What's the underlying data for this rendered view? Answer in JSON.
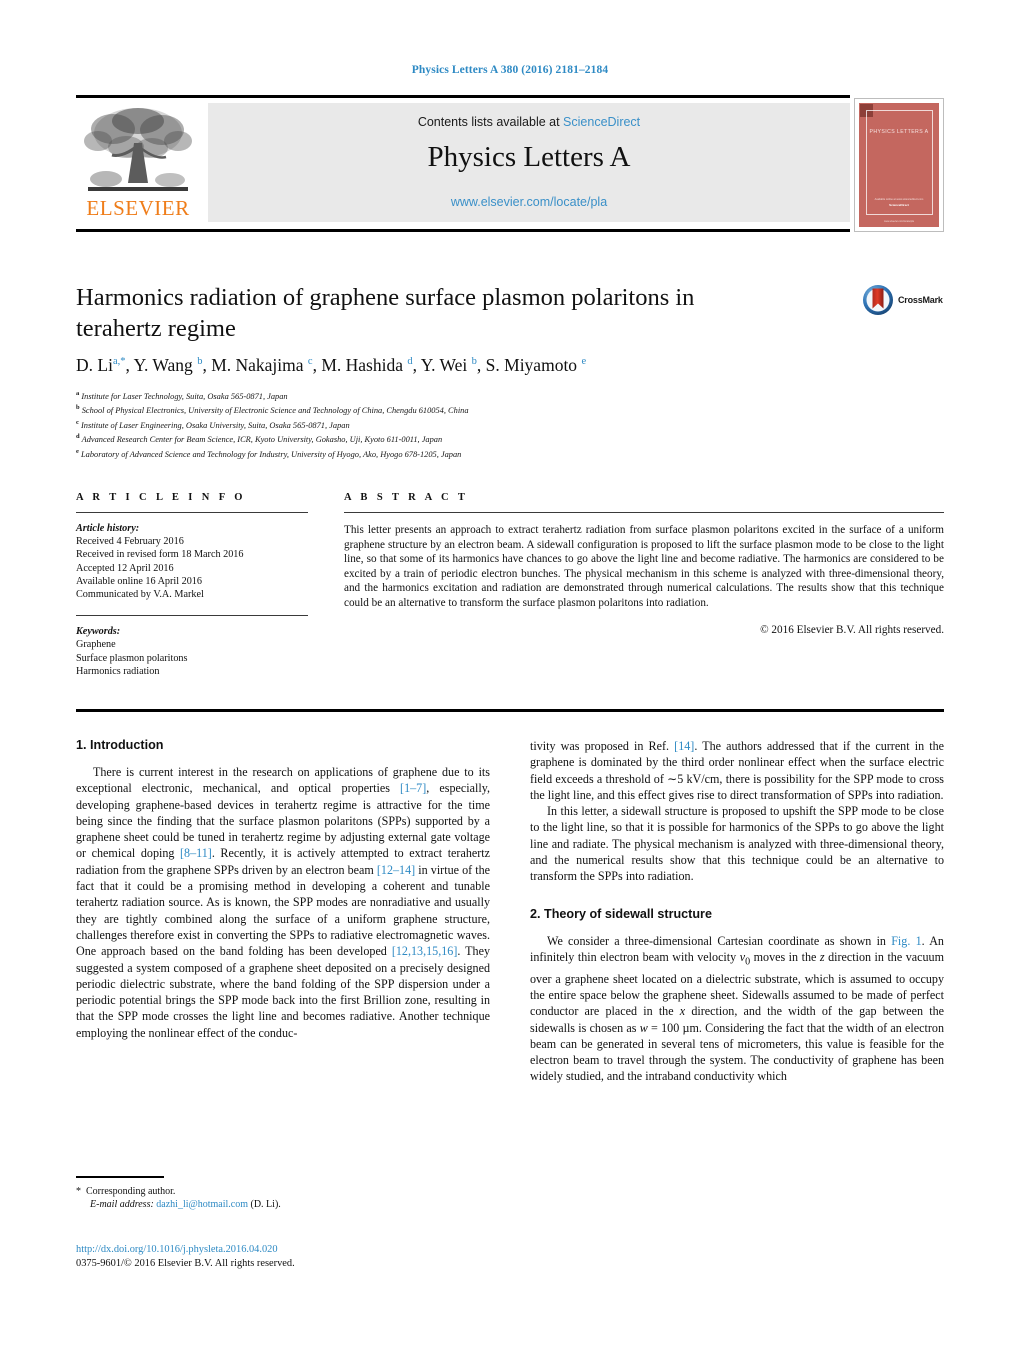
{
  "running_head": "Physics Letters A 380 (2016) 2181–2184",
  "masthead": {
    "contents_prefix": "Contents lists available at ",
    "contents_link": "ScienceDirect",
    "journal_title": "Physics Letters A",
    "journal_url": "www.elsevier.com/locate/pla",
    "publisher_logo_word": "ELSEVIER",
    "cover": {
      "name": "PHYSICS LETTERS A",
      "foot1": "Available online at www.sciencedirect.com",
      "foot2": "ScienceDirect",
      "foot3": "www.elsevier.com/locate/pla"
    }
  },
  "article": {
    "title": "Harmonics radiation of graphene surface plasmon polaritons in terahertz regime",
    "crossmark_label": "CrossMark",
    "authors_html": "D. Li<sup class=\"star\">a,*</sup>, Y. Wang <sup>b</sup>, M. Nakajima <sup>c</sup>, M. Hashida <sup>d</sup>, Y. Wei <sup>b</sup>, S. Miyamoto <sup>e</sup>",
    "affiliations": [
      {
        "marker": "a",
        "text": "Institute for Laser Technology, Suita, Osaka 565-0871, Japan"
      },
      {
        "marker": "b",
        "text": "School of Physical Electronics, University of Electronic Science and Technology of China, Chengdu 610054, China"
      },
      {
        "marker": "c",
        "text": "Institute of Laser Engineering, Osaka University, Suita, Osaka 565-0871, Japan"
      },
      {
        "marker": "d",
        "text": "Advanced Research Center for Beam Science, ICR, Kyoto University, Gokasho, Uji, Kyoto 611-0011, Japan"
      },
      {
        "marker": "e",
        "text": "Laboratory of Advanced Science and Technology for Industry, University of Hyogo, Ako, Hyogo 678-1205, Japan"
      }
    ]
  },
  "article_info": {
    "heading": "A R T I C L E   I N F O",
    "history_label": "Article history:",
    "history": [
      "Received 4 February 2016",
      "Received in revised form 18 March 2016",
      "Accepted 12 April 2016",
      "Available online 16 April 2016",
      "Communicated by V.A. Markel"
    ],
    "keywords_label": "Keywords:",
    "keywords": [
      "Graphene",
      "Surface plasmon polaritons",
      "Harmonics radiation"
    ]
  },
  "abstract": {
    "heading": "A B S T R A C T",
    "text": "This letter presents an approach to extract terahertz radiation from surface plasmon polaritons excited in the surface of a uniform graphene structure by an electron beam. A sidewall configuration is proposed to lift the surface plasmon mode to be close to the light line, so that some of its harmonics have chances to go above the light line and become radiative. The harmonics are considered to be excited by a train of periodic electron bunches. The physical mechanism in this scheme is analyzed with three-dimensional theory, and the harmonics excitation and radiation are demonstrated through numerical calculations. The results show that this technique could be an alternative to transform the surface plasmon polaritons into radiation.",
    "copyright": "© 2016 Elsevier B.V. All rights reserved."
  },
  "sections": {
    "intro_heading": "1. Introduction",
    "theory_heading": "2. Theory of sidewall structure",
    "intro_p1_html": "There is current interest in the research on applications of graphene due to its exceptional electronic, mechanical, and optical properties <a class=\"ref\" href=\"#\">[1–7]</a>, especially, developing graphene-based devices in terahertz regime is attractive for the time being since the finding that the surface plasmon polaritons (SPPs) supported by a graphene sheet could be tuned in terahertz regime by adjusting external gate voltage or chemical doping <a class=\"ref\" href=\"#\">[8–11]</a>. Recently, it is actively attempted to extract terahertz radiation from the graphene SPPs driven by an electron beam <a class=\"ref\" href=\"#\">[12–14]</a> in virtue of the fact that it could be a promising method in developing a coherent and tunable terahertz radiation source. As is known, the SPP modes are nonradiative and usually they are tightly combined along the surface of a uniform graphene structure, challenges therefore exist in converting the SPPs to radiative electromagnetic waves. One approach based on the band folding has been developed <a class=\"ref\" href=\"#\">[12,13,15,16]</a>. They suggested a system composed of a graphene sheet deposited on a precisely designed periodic dielectric substrate, where the band folding of the SPP dispersion under a periodic potential brings the SPP mode back into the first Brillion zone, resulting in that the SPP mode crosses the light line and becomes radiative. Another technique employing the nonlinear effect of the conduc-",
    "right_p1_html": "tivity was proposed in Ref. <a class=\"ref\" href=\"#\">[14]</a>. The authors addressed that if the current in the graphene is dominated by the third order nonlinear effect when the surface electric field exceeds a threshold of ∼5 kV/cm, there is possibility for the SPP mode to cross the light line, and this effect gives rise to direct transformation of SPPs into radiation.",
    "right_p2_html": "In this letter, a sidewall structure is proposed to upshift the SPP mode to be close to the light line, so that it is possible for harmonics of the SPPs to go above the light line and radiate. The physical mechanism is analyzed with three-dimensional theory, and the numerical results show that this technique could be an alternative to transform the SPPs into radiation.",
    "right_p3_html": "We consider a three-dimensional Cartesian coordinate as shown in <a class=\"ref\" href=\"#\">Fig. 1</a>. An infinitely thin electron beam with velocity <span class=\"em\">v</span><sub>0</sub> moves in the <span class=\"em\">z</span> direction in the vacuum over a graphene sheet located on a dielectric substrate, which is assumed to occupy the entire space below the graphene sheet. Sidewalls assumed to be made of perfect conductor are placed in the <span class=\"em\">x</span> direction, and the width of the gap between the sidewalls is chosen as <span class=\"em\">w</span> = 100 µm. Considering the fact that the width of an electron beam can be generated in several tens of micrometers, this value is feasible for the electron beam to travel through the system. The conductivity of graphene has been widely studied, and the intraband conductivity which"
  },
  "footnotes": {
    "corresponding_marker": "*",
    "corresponding_text": "Corresponding author.",
    "email_label": "E-mail address:",
    "email": "dazhi_li@hotmail.com",
    "email_owner": "(D. Li).",
    "doi_url": "http://dx.doi.org/10.1016/j.physleta.2016.04.020",
    "issn_line": "0375-9601/© 2016 Elsevier B.V. All rights reserved."
  },
  "colors": {
    "link": "#2e8ac4",
    "elsevier_orange": "#ef7d1a",
    "cover_red": "#c4675f",
    "grey_box": "#e9e9e9"
  }
}
